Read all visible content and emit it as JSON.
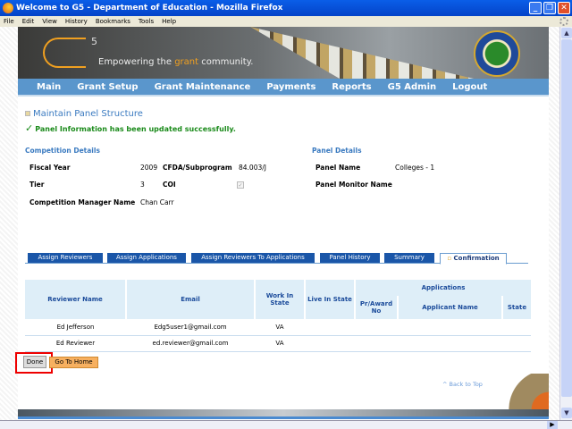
{
  "window": {
    "title": "Welcome to G5 - Department of Education - Mozilla Firefox",
    "menu": [
      "File",
      "Edit",
      "View",
      "History",
      "Bookmarks",
      "Tools",
      "Help"
    ]
  },
  "banner": {
    "logo_five": "5",
    "tagline_pre": "Empowering the ",
    "tagline_accent": "grant",
    "tagline_post": " community.",
    "accent_color": "#f0a020"
  },
  "nav": [
    "Main",
    "Grant Setup",
    "Grant Maintenance",
    "Payments",
    "Reports",
    "G5 Admin",
    "Logout"
  ],
  "page": {
    "title": "Maintain Panel Structure",
    "success": "Panel Information has been updated successfully."
  },
  "competition": {
    "heading": "Competition Details",
    "fiscal_year_label": "Fiscal Year",
    "fiscal_year": "2009",
    "cfda_label": "CFDA/Subprogram",
    "cfda": "84.003/J",
    "tier_label": "Tier",
    "tier": "3",
    "coi_label": "COI",
    "coi_checked": true,
    "manager_label": "Competition Manager Name",
    "manager": "Chan Carr"
  },
  "panel": {
    "heading": "Panel Details",
    "name_label": "Panel Name",
    "name": "Colleges - 1",
    "monitor_label": "Panel Monitor Name"
  },
  "tabs": [
    "Assign Reviewers",
    "Assign Applications",
    "Assign Reviewers To Applications",
    "Panel History",
    "Summary",
    "Confirmation"
  ],
  "active_tab": "Confirmation",
  "table": {
    "headers": {
      "reviewer": "Reviewer Name",
      "email": "Email",
      "work": "Work In State",
      "live": "Live In State",
      "applications": "Applications",
      "pr": "Pr/Award No",
      "applicant": "Applicant Name",
      "state": "State"
    },
    "rows": [
      {
        "name": "Ed Jefferson",
        "email": "Edg5user1@gmail.com",
        "work": "VA"
      },
      {
        "name": "Ed Reviewer",
        "email": "ed.reviewer@gmail.com",
        "work": "VA"
      }
    ]
  },
  "buttons": {
    "done": "Done",
    "home": "Go To Home"
  },
  "back_to_top": "^ Back to Top"
}
